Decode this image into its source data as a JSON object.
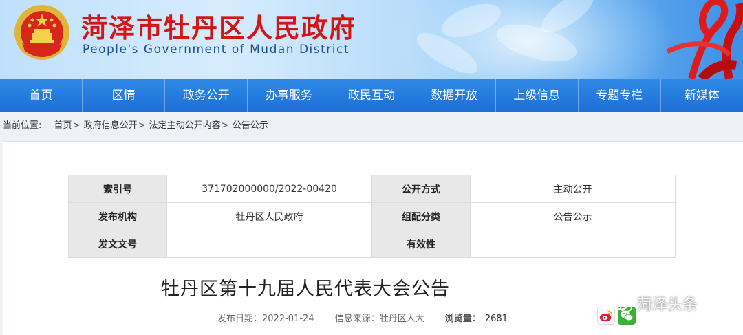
{
  "header": {
    "title": "菏泽市牡丹区人民政府",
    "subtitle": "People's Government of Mudan District",
    "emblem_icon": "national-emblem-icon",
    "decoration_icon": "red-ribbon-knot-icon",
    "title_color": "#d41515"
  },
  "nav": {
    "items": [
      "首页",
      "区情",
      "政务公开",
      "办事服务",
      "政民互动",
      "数据开放",
      "上级信息",
      "专题专栏",
      "新媒体"
    ],
    "background_color": "#1d6fd6"
  },
  "breadcrumb": {
    "label": "当前位置:",
    "items": [
      "首页",
      "政府信息公开",
      "法定主动公开内容",
      "公告公示"
    ],
    "separator": ">"
  },
  "meta_table": {
    "rows": [
      [
        {
          "key": "索引号",
          "value": "371702000000/2022-00420"
        },
        {
          "key": "公开方式",
          "value": "主动公开"
        }
      ],
      [
        {
          "key": "发布机构",
          "value": "牡丹区人民政府"
        },
        {
          "key": "组配分类",
          "value": "公告公示"
        }
      ],
      [
        {
          "key": "发文文号",
          "value": ""
        },
        {
          "key": "有效性",
          "value": ""
        }
      ]
    ]
  },
  "article": {
    "title": "牡丹区第十九届人民代表大会公告",
    "publish_date": "发布日期：2022-01-24",
    "source": "信息来源：牡丹区人大",
    "views_label": "浏览量：",
    "views": "2681"
  },
  "share": {
    "weibo_icon": "weibo-icon",
    "wechat_icon": "wechat-icon"
  },
  "watermark": {
    "text": "菏泽头条",
    "icon": "wechat-bubble-icon"
  }
}
